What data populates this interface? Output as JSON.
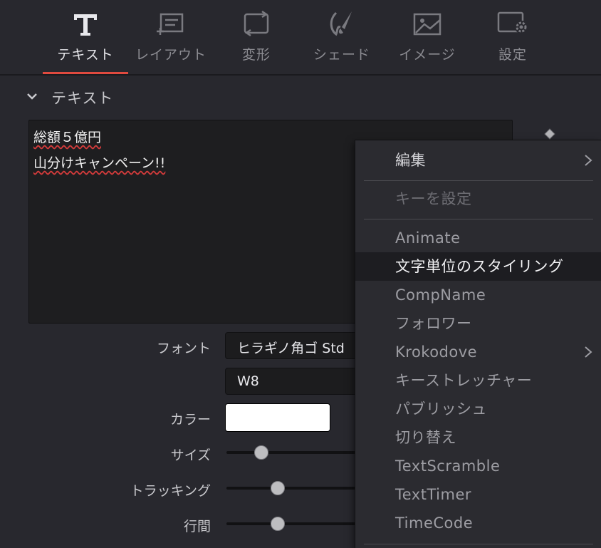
{
  "tabs": [
    {
      "label": "テキスト",
      "icon": "text-T-icon",
      "active": true
    },
    {
      "label": "レイアウト",
      "icon": "layout-icon",
      "active": false
    },
    {
      "label": "変形",
      "icon": "transform-icon",
      "active": false
    },
    {
      "label": "シェード",
      "icon": "brush-icon",
      "active": false
    },
    {
      "label": "イメージ",
      "icon": "image-icon",
      "active": false
    },
    {
      "label": "設定",
      "icon": "settings-gear-icon",
      "active": false
    }
  ],
  "section": {
    "title": "テキスト"
  },
  "styled_text": {
    "line1": "総額５億円",
    "line2": "山分けキャンペーン!!"
  },
  "props": {
    "font_label": "フォント",
    "font_value": "ヒラギノ角ゴ Std",
    "weight_value": "W8",
    "color_label": "カラー",
    "color_value": "#ffffff",
    "size_label": "サイズ",
    "size_level": 0.26,
    "tracking_label": "トラッキング",
    "tracking_level": 0.38,
    "line_spacing_label": "行間",
    "line_spacing_level": 0.38
  },
  "context_menu": {
    "items": [
      {
        "label": "編集",
        "submenu": true,
        "state": "bright"
      },
      {
        "label": "キーを設定",
        "submenu": false,
        "state": "disabled"
      },
      {
        "label": "Animate",
        "submenu": false,
        "state": "normal"
      },
      {
        "label": "文字単位のスタイリング",
        "submenu": false,
        "state": "highlighted"
      },
      {
        "label": "CompName",
        "submenu": false,
        "state": "normal"
      },
      {
        "label": "フォロワー",
        "submenu": false,
        "state": "normal"
      },
      {
        "label": "Krokodove",
        "submenu": true,
        "state": "normal"
      },
      {
        "label": "キーストレッチャー",
        "submenu": false,
        "state": "normal"
      },
      {
        "label": "パブリッシュ",
        "submenu": false,
        "state": "normal"
      },
      {
        "label": "切り替え",
        "submenu": false,
        "state": "normal"
      },
      {
        "label": "TextScramble",
        "submenu": false,
        "state": "normal"
      },
      {
        "label": "TextTimer",
        "submenu": false,
        "state": "normal"
      },
      {
        "label": "TimeCode",
        "submenu": false,
        "state": "normal"
      }
    ]
  },
  "colors": {
    "accent": "#e04a3f",
    "background": "#28282e",
    "menu_bg": "#2b2b30",
    "highlight_bg": "#1d1d21"
  }
}
